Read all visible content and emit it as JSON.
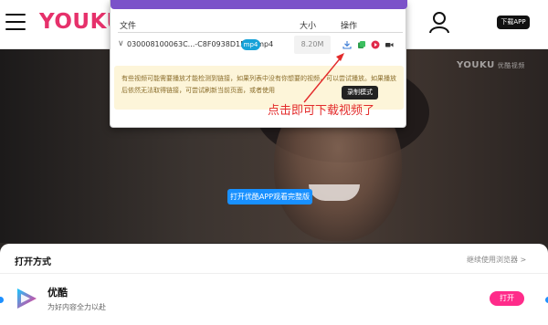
{
  "header": {
    "logo_text": "YOUKU",
    "download_app_label": "下载APP"
  },
  "video": {
    "watermark": "YOUKU",
    "watermark_sub": "优酷视频",
    "open_app_button": "打开优酷APP观看完整版"
  },
  "downloader": {
    "columns": {
      "file": "文件",
      "size": "大小",
      "ops": "操作"
    },
    "file": {
      "name": "030008100063C...-C8F0938D15BE.mp4",
      "format_badge": "mp4",
      "size": "8.20M"
    },
    "operations": [
      "download-icon",
      "copy-link-icon",
      "play-icon",
      "record-icon"
    ],
    "notice_text": "有些视频可能需要播放才能检测到链接，如果列表中没有你想要的视频，可以尝试播放。如果播放后依然无法取得链接，可尝试刷新当前页面，或者使用",
    "tooltip": "录制模式"
  },
  "annotation": {
    "text": "点击即可下载视频了",
    "color": "#e32b2b"
  },
  "sheet": {
    "title": "打开方式",
    "continue_browser": "继续使用浏览器 >",
    "app_name": "优酷",
    "app_desc": "为好内容全力以赴",
    "open_button": "打开"
  },
  "colors": {
    "brand_pink": "#e6316b",
    "popup_purple": "#7b52c9",
    "badge_blue": "#17a2d8",
    "open_btn": "#ff2b8a",
    "app_btn_blue": "#1890ff"
  }
}
